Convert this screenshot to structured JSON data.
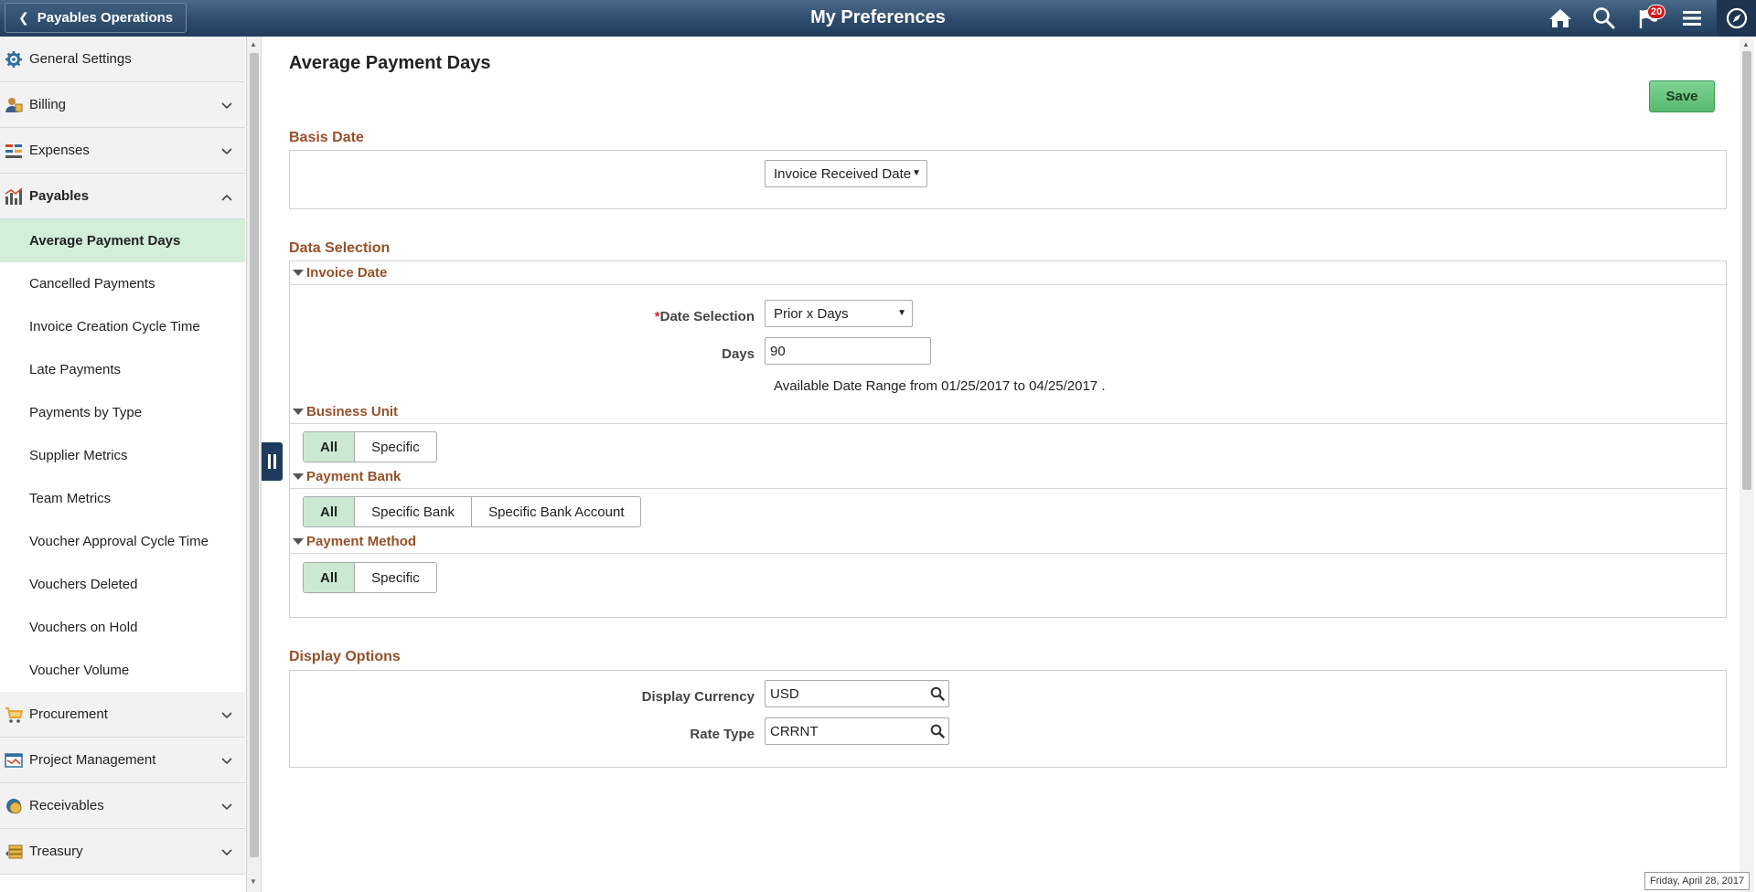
{
  "header": {
    "back_label": "Payables Operations",
    "title": "My Preferences",
    "notifications_count": "20",
    "icons": [
      "home-icon",
      "search-icon",
      "notifications-flag-icon",
      "menu-icon",
      "navbar-compass-icon"
    ]
  },
  "sidebar": {
    "categories": [
      {
        "label": "General Settings",
        "icon": "gear-icon"
      },
      {
        "label": "Billing",
        "icon": "billing-icon"
      },
      {
        "label": "Expenses",
        "icon": "expenses-icon"
      },
      {
        "label": "Payables",
        "icon": "payables-chart-icon"
      },
      {
        "label": "Procurement",
        "icon": "cart-icon"
      },
      {
        "label": "Project Management",
        "icon": "project-icon"
      },
      {
        "label": "Receivables",
        "icon": "receivables-icon"
      },
      {
        "label": "Treasury",
        "icon": "treasury-icon"
      }
    ],
    "payables_items": [
      "Average Payment Days",
      "Cancelled Payments",
      "Invoice Creation Cycle Time",
      "Late Payments",
      "Payments by Type",
      "Supplier Metrics",
      "Team Metrics",
      "Voucher Approval Cycle Time",
      "Vouchers Deleted",
      "Vouchers on Hold",
      "Voucher Volume"
    ]
  },
  "main": {
    "page_title": "Average Payment Days",
    "save_label": "Save",
    "basis_date": {
      "title": "Basis Date",
      "selected": "Invoice Received Date"
    },
    "data_selection": {
      "title": "Data Selection",
      "invoice_date": {
        "title": "Invoice Date",
        "date_selection_label": "Date Selection",
        "date_selection_value": "Prior x Days",
        "days_label": "Days",
        "days_value": "90",
        "range_note": "Available Date Range from 01/25/2017  to 04/25/2017 ."
      },
      "business_unit": {
        "title": "Business Unit",
        "options": [
          "All",
          "Specific"
        ],
        "selected": "All"
      },
      "payment_bank": {
        "title": "Payment Bank",
        "options": [
          "All",
          "Specific Bank",
          "Specific Bank Account"
        ],
        "selected": "All"
      },
      "payment_method": {
        "title": "Payment Method",
        "options": [
          "All",
          "Specific"
        ],
        "selected": "All"
      }
    },
    "display_options": {
      "title": "Display Options",
      "currency_label": "Display Currency",
      "currency_value": "USD",
      "rate_type_label": "Rate Type",
      "rate_type_value": "CRRNT"
    }
  },
  "status": {
    "date_text": "Friday, April 28, 2017"
  },
  "colors": {
    "header": "#2d4b6c",
    "section_title": "#96512a",
    "active_item": "#d3eed9",
    "save_button": "#58b86f"
  }
}
